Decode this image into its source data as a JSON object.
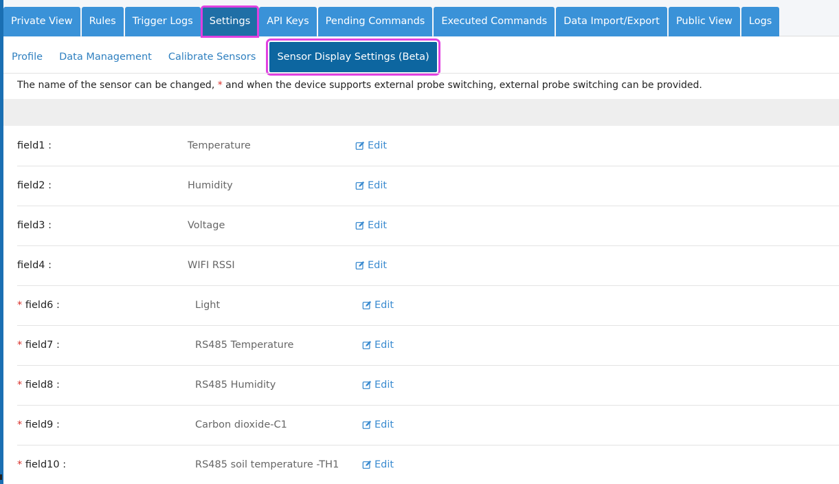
{
  "main_tabs": [
    {
      "label": "Private View"
    },
    {
      "label": "Rules"
    },
    {
      "label": "Trigger Logs"
    },
    {
      "label": "Settings"
    },
    {
      "label": "API Keys"
    },
    {
      "label": "Pending Commands"
    },
    {
      "label": "Executed Commands"
    },
    {
      "label": "Data Import/Export"
    },
    {
      "label": "Public View"
    },
    {
      "label": "Logs"
    }
  ],
  "active_main_tab": "Settings",
  "sub_tabs": [
    {
      "label": "Profile"
    },
    {
      "label": "Data Management"
    },
    {
      "label": "Calibrate Sensors"
    },
    {
      "label": "Sensor Display Settings (Beta)"
    }
  ],
  "active_sub_tab": "Sensor Display Settings (Beta)",
  "description": {
    "before": "The name of the sensor can be changed, ",
    "star": "*",
    "after": " and when the device supports external probe switching, external probe switching can be provided."
  },
  "fields": [
    {
      "star": "",
      "label": "field1 :",
      "value": "Temperature",
      "edit": "Edit"
    },
    {
      "star": "",
      "label": "field2 :",
      "value": "Humidity",
      "edit": "Edit"
    },
    {
      "star": "",
      "label": "field3 :",
      "value": "Voltage",
      "edit": "Edit"
    },
    {
      "star": "",
      "label": "field4 :",
      "value": "WIFI RSSI",
      "edit": "Edit"
    },
    {
      "star": "*",
      "label": "field6 :",
      "value": "Light",
      "edit": "Edit"
    },
    {
      "star": "*",
      "label": "field7 :",
      "value": "RS485 Temperature",
      "edit": "Edit"
    },
    {
      "star": "*",
      "label": "field8 :",
      "value": "RS485 Humidity",
      "edit": "Edit"
    },
    {
      "star": "*",
      "label": "field9 :",
      "value": "Carbon dioxide-C1",
      "edit": "Edit"
    },
    {
      "star": "*",
      "label": "field10 :",
      "value": "RS485 soil temperature -TH1",
      "edit": "Edit"
    }
  ],
  "icons": {
    "edit": "edit-icon"
  },
  "colors": {
    "tab": "#3a92d8",
    "tab_active": "#1f6fa6",
    "highlight": "#e040e0",
    "link": "#3a8bd0",
    "star": "#d9302a"
  }
}
